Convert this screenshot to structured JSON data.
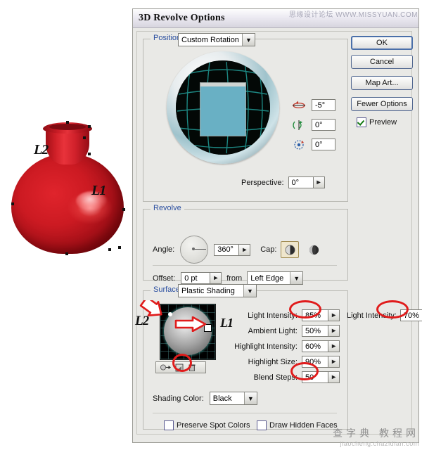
{
  "window": {
    "title": "3D Revolve Options"
  },
  "watermarks": {
    "top_right": "思缘设计论坛  WWW.MISSYUAN.COM",
    "bottom_right_cn": "查字典 教程网",
    "bottom_right_url": "jiaocheng.chazidian.com"
  },
  "artwork": {
    "name": "red-vase",
    "labels": [
      {
        "text": "L2",
        "note": "upper-left light label"
      },
      {
        "text": "L1",
        "note": "right highlight label"
      }
    ],
    "color": "#cc1a22"
  },
  "position": {
    "group_label": "Position:",
    "preset": "Custom Rotation",
    "rotations": [
      {
        "axis": "x",
        "icon": "rotate-x-icon",
        "value": "-5°"
      },
      {
        "axis": "y",
        "icon": "rotate-y-icon",
        "value": "0°"
      },
      {
        "axis": "z",
        "icon": "rotate-z-icon",
        "value": "0°"
      }
    ],
    "perspective_label": "Perspective:",
    "perspective_value": "0°"
  },
  "revolve": {
    "group_label": "Revolve",
    "angle_label": "Angle:",
    "angle_value": "360°",
    "cap_label": "Cap:",
    "cap_on_selected": true,
    "offset_label": "Offset:",
    "offset_value": "0 pt",
    "from_label": "from",
    "from_value": "Left Edge"
  },
  "surface": {
    "group_label": "Surface:",
    "shading": "Plastic Shading",
    "fields": [
      {
        "label": "Light Intensity:",
        "value": "85%",
        "highlighted": true
      },
      {
        "label": "Ambient Light:",
        "value": "50%",
        "highlighted": false
      },
      {
        "label": "Highlight Intensity:",
        "value": "60%",
        "highlighted": false
      },
      {
        "label": "Highlight Size:",
        "value": "90%",
        "highlighted": false
      },
      {
        "label": "Blend Steps:",
        "value": "50",
        "highlighted": true
      }
    ],
    "second_light": {
      "label": "Light Intensity:",
      "value": "70%",
      "highlighted": true
    },
    "shading_color_label": "Shading Color:",
    "shading_color_value": "Black",
    "preserve_spot_colors": {
      "label": "Preserve Spot Colors",
      "checked": false
    },
    "draw_hidden_faces": {
      "label": "Draw Hidden Faces",
      "checked": false
    },
    "light_buttons": [
      {
        "name": "move-light-back-icon"
      },
      {
        "name": "new-light-icon"
      },
      {
        "name": "delete-light-icon"
      }
    ],
    "sphere_labels": [
      {
        "text": "L2"
      },
      {
        "text": "L1"
      }
    ]
  },
  "buttons": {
    "ok": "OK",
    "cancel": "Cancel",
    "map_art": "Map Art...",
    "fewer_options": "Fewer Options",
    "preview_label": "Preview",
    "preview_checked": true
  },
  "colors": {
    "accent_blue": "#2b4fa0",
    "annotation_red": "#e01b1b",
    "dialog_bg": "#e9e9e6",
    "cube_face": "#69b0c4"
  }
}
